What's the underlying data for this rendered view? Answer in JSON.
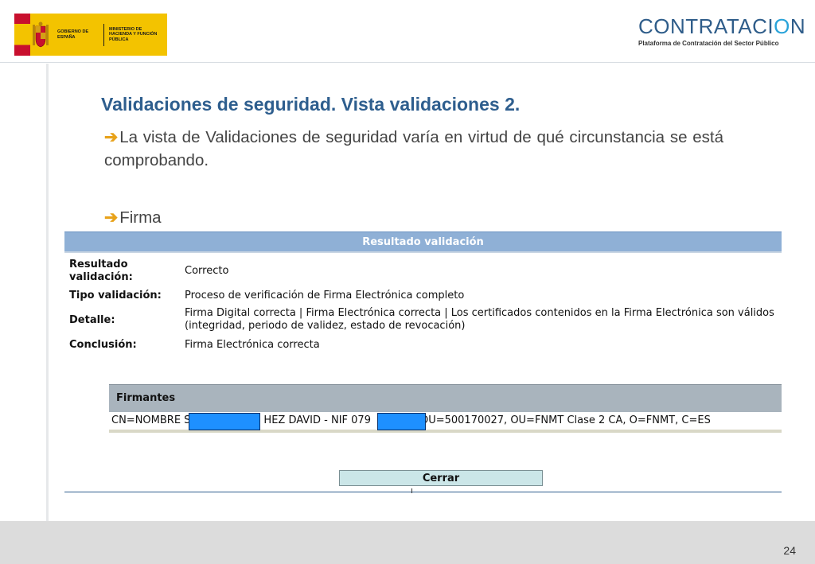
{
  "header": {
    "gov_line1": "Gobierno de España",
    "gov_line2": "Ministerio de Hacienda y Función Pública",
    "brand_main": "CONTRATACI",
    "brand_power": "O",
    "brand_end": "N",
    "brand_sub": "Plataforma de Contratación del Sector Público"
  },
  "slide": {
    "title": "Validaciones de seguridad. Vista validaciones 2.",
    "bullet_glyph": "➔",
    "bullet1": "La vista de Validaciones de seguridad varía en virtud de qué circunstancia se está comprobando.",
    "bullet2": "Firma"
  },
  "dialog": {
    "header": "Resultado validación",
    "rows": [
      {
        "label": "Resultado validación:",
        "value": "Correcto"
      },
      {
        "label": "Tipo validación:",
        "value": "Proceso de verificación de Firma Electrónica completo"
      },
      {
        "label": "Detalle:",
        "value": "Firma Digital correcta | Firma Electrónica correcta | Los certificados contenidos en la Firma Electrónica son válidos (integridad, periodo de validez, estado de revocación)"
      },
      {
        "label": "Conclusión:",
        "value": "Firma Electrónica correcta"
      }
    ],
    "signers_header": "Firmantes",
    "signer_part1": "CN=NOMBRE S",
    "signer_part2": "HEZ DAVID - NIF 079",
    "signer_part3": "OU=500170027, OU=FNMT Clase 2 CA, O=FNMT, C=ES",
    "close_label": "Cerrar"
  },
  "footer": {
    "page_number": "24"
  },
  "colors": {
    "title": "#2e5e8e",
    "bullet_arrow": "#e8a21a",
    "dialog_header": "#8fb0d6",
    "signers_header": "#a9b4bd",
    "redaction": "#1e90ff",
    "close_button": "#cbe6e8"
  }
}
